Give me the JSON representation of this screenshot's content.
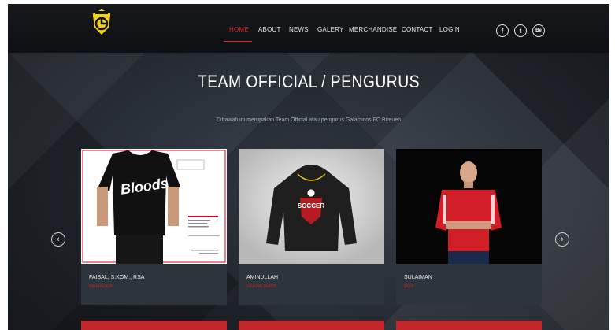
{
  "nav": {
    "items": [
      {
        "label": "HOME",
        "active": true
      },
      {
        "label": "ABOUT",
        "active": false
      },
      {
        "label": "NEWS",
        "active": false
      },
      {
        "label": "GALERY",
        "active": false
      },
      {
        "label": "MERCHANDISE",
        "active": false
      },
      {
        "label": "CONTACT",
        "active": false
      },
      {
        "label": "LOGIN",
        "active": false
      }
    ],
    "social": [
      {
        "icon": "facebook-icon",
        "glyph": "f"
      },
      {
        "icon": "twitter-icon",
        "glyph": "t"
      },
      {
        "icon": "behance-icon",
        "glyph": "Bē"
      }
    ]
  },
  "hero": {
    "title": "TEAM OFFICIAL / PENGURUS",
    "subtitle": "Dibawah ini merupakan Team Official atau pengurus Galacticos FC Bireuen"
  },
  "cards": [
    {
      "name": "FAISAL, S.KOM., RSA",
      "role": "MANAGER",
      "image": "tshirt-photo",
      "shirt_text": "Bloods"
    },
    {
      "name": "AMINULLAH",
      "role": "SEKRETARIS",
      "image": "hoodie-photo",
      "shirt_text": "SOCCER"
    },
    {
      "name": "SULAIMAN",
      "role": "BOS",
      "image": "player-photo"
    }
  ],
  "colors": {
    "accent": "#d9262b",
    "navbar": "#131518",
    "card": "#2e343c",
    "background": "#2a3038"
  }
}
